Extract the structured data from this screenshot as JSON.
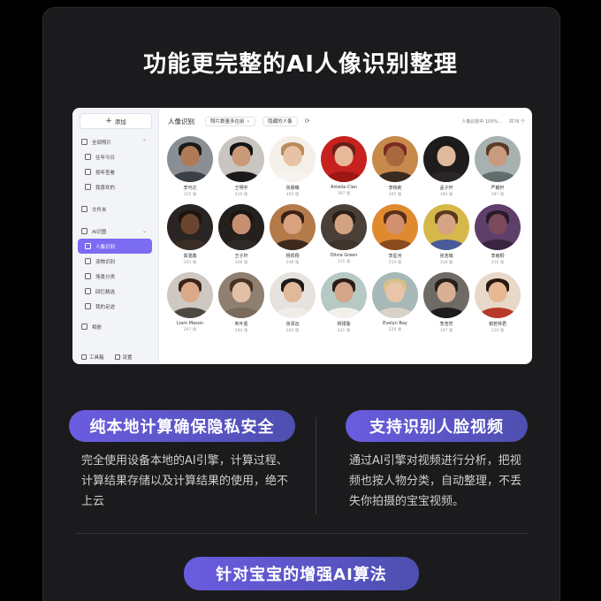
{
  "headline": "功能更完整的AI人像识别整理",
  "app": {
    "sidebar": {
      "add_label": "添加",
      "items": [
        {
          "label": "全部照片",
          "caret": "⌃",
          "icon": "photos-icon"
        },
        {
          "label": "往年今日",
          "icon": "calendar-icon"
        },
        {
          "label": "按年查看",
          "icon": "year-icon"
        },
        {
          "label": "我喜欢的",
          "icon": "heart-icon"
        },
        {
          "label": "文件夹",
          "icon": "folder-icon"
        },
        {
          "label": "AI识图",
          "caret": "⌄",
          "icon": "ai-icon"
        },
        {
          "label": "人像识别",
          "icon": "person-icon"
        },
        {
          "label": "宠物识别",
          "icon": "pet-icon"
        },
        {
          "label": "场景分类",
          "icon": "scene-icon"
        },
        {
          "label": "回忆精选",
          "icon": "memory-icon"
        },
        {
          "label": "我的足迹",
          "icon": "footprint-icon"
        },
        {
          "label": "相册",
          "icon": "album-icon"
        }
      ],
      "bottom": {
        "tools": "工具箱",
        "settings": "设置"
      }
    },
    "toolbar": {
      "title": "人像识别",
      "sort_chip": "照片数量多在前",
      "hidden_chip": "隐藏的人像",
      "status": "人像识别中 100%...",
      "count": "共76 个"
    },
    "people": [
      {
        "name": "李可达",
        "count": "325 张",
        "bg": "#8a8f94",
        "skin": "#b07a57",
        "hair": "#1d1a18",
        "cloth": "#3b4046"
      },
      {
        "name": "王明宇",
        "count": "419 张",
        "bg": "#c9c6c1",
        "skin": "#c99978",
        "hair": "#141414",
        "cloth": "#1a1a1a"
      },
      {
        "name": "张晨曦",
        "count": "405 张",
        "bg": "#f4efe8",
        "skin": "#e7c2a5",
        "hair": "#b98a5a",
        "cloth": "#f7f3ee"
      },
      {
        "name": "Amelia Clan",
        "count": "387 张",
        "bg": "#c6211f",
        "skin": "#e8b89a",
        "hair": "#6a1e14",
        "cloth": "#9e1712"
      },
      {
        "name": "李晓莉",
        "count": "391 张",
        "bg": "#c88a4b",
        "skin": "#a8683d",
        "hair": "#7a2a22",
        "cloth": "#3a2a20"
      },
      {
        "name": "孟子轩",
        "count": "389 张",
        "bg": "#1f1c1e",
        "skin": "#e0b89c",
        "hair": "#1a1a1a",
        "cloth": "#2a2528"
      },
      {
        "name": "严朗轩",
        "count": "387 张",
        "bg": "#a7b2b0",
        "skin": "#c99b7e",
        "hair": "#5b3b28",
        "cloth": "#5f6e6d"
      },
      {
        "name": "高湛鑫",
        "count": "345 张",
        "bg": "#2a2522",
        "skin": "#6b4430",
        "hair": "#1c1410",
        "cloth": "#3a2e26"
      },
      {
        "name": "王子轩",
        "count": "308 张",
        "bg": "#23201d",
        "skin": "#c69070",
        "hair": "#1a1513",
        "cloth": "#2e2a27"
      },
      {
        "name": "杨凯翔",
        "count": "246 张",
        "bg": "#b47a4a",
        "skin": "#d8a27e",
        "hair": "#3a2116",
        "cloth": "#3d2a1d"
      },
      {
        "name": "Olivia Green",
        "count": "331 张",
        "bg": "#4a4038",
        "skin": "#d2a383",
        "hair": "#2a1e16",
        "cloth": "#3e342c"
      },
      {
        "name": "李星河",
        "count": "254 张",
        "bg": "#e08a30",
        "skin": "#d29070",
        "hair": "#5a2e18",
        "cloth": "#8a4a1e"
      },
      {
        "name": "张浩瑞",
        "count": "318 张",
        "bg": "#d6b84a",
        "skin": "#d4a484",
        "hair": "#5a3820",
        "cloth": "#4a5a9a"
      },
      {
        "name": "李雨桐",
        "count": "310 张",
        "bg": "#5e3f6a",
        "skin": "#7a4a5a",
        "hair": "#2a1a2a",
        "cloth": "#3a2540"
      },
      {
        "name": "Liam Mason",
        "count": "297 张",
        "bg": "#cdc8c2",
        "skin": "#d9a988",
        "hair": "#3a2418",
        "cloth": "#4e4842"
      },
      {
        "name": "朱叶嘉",
        "count": "284 张",
        "bg": "#8f7f70",
        "skin": "#e2c0a6",
        "hair": "#4a3222",
        "cloth": "#7a6a5e"
      },
      {
        "name": "张泽远",
        "count": "283 张",
        "bg": "#e6e2de",
        "skin": "#e0b89a",
        "hair": "#1e1a18",
        "cloth": "#f0ece8"
      },
      {
        "name": "杨瑾璇",
        "count": "241 张",
        "bg": "#b6c9c4",
        "skin": "#d3a58a",
        "hair": "#2a1c14",
        "cloth": "#f3f0ea"
      },
      {
        "name": "Evelyn Bay",
        "count": "220 张",
        "bg": "#a7b8b8",
        "skin": "#e8c4a8",
        "hair": "#d8c08a",
        "cloth": "#d8d2c8"
      },
      {
        "name": "李浩然",
        "count": "197 张",
        "bg": "#6e6a66",
        "skin": "#d9b094",
        "hair": "#2a201a",
        "cloth": "#1c1c1c"
      },
      {
        "name": "谢若林君",
        "count": "110 张",
        "bg": "#e8d8c8",
        "skin": "#e6b894",
        "hair": "#2a1a12",
        "cloth": "#b83a2a"
      }
    ]
  },
  "features": {
    "local": {
      "title": "纯本地计算确保隐私安全",
      "text": "完全使用设备本地的AI引擎，计算过程、计算结果存储以及计算结果的使用，绝不上云"
    },
    "video": {
      "title": "支持识别人脸视频",
      "text": "通过AI引擎对视频进行分析，把视频也按人物分类，自动整理，不丢失你拍摄的宝宝视频。"
    },
    "baby": {
      "title": "针对宝宝的增强AI算法"
    }
  }
}
